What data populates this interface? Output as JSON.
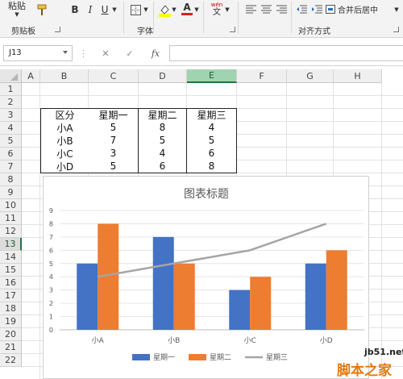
{
  "ribbon": {
    "paste_label": "粘贴",
    "bold": "B",
    "italic": "I",
    "underline": "U",
    "font_color_letter": "A",
    "phonetic_label": "wén",
    "phonetic_char": "文",
    "merge_center_label": "合并后居中",
    "groups": {
      "clipboard": "剪贴板",
      "font": "字体",
      "alignment": "对齐方式"
    }
  },
  "formula_bar": {
    "name_box": "J13",
    "cancel": "✕",
    "enter": "✓",
    "fx": "fx",
    "formula": ""
  },
  "sheet": {
    "columns": [
      "A",
      "B",
      "C",
      "D",
      "E",
      "F",
      "G",
      "H"
    ],
    "active_column": "E",
    "rows": [
      "1",
      "2",
      "3",
      "4",
      "5",
      "6",
      "7",
      "8",
      "9",
      "10",
      "11",
      "12",
      "13",
      "14",
      "15",
      "16",
      "17",
      "18",
      "19",
      "20",
      "21",
      "22"
    ],
    "active_row": "13",
    "table": {
      "header": [
        "区分",
        "星期一",
        "星期二",
        "星期三"
      ],
      "rows": [
        [
          "小A",
          "5",
          "8",
          "4"
        ],
        [
          "小B",
          "7",
          "5",
          "5"
        ],
        [
          "小C",
          "3",
          "4",
          "6"
        ],
        [
          "小D",
          "5",
          "6",
          "8"
        ]
      ]
    }
  },
  "chart_data": {
    "type": "bar",
    "title": "图表标题",
    "categories": [
      "小A",
      "小B",
      "小C",
      "小D"
    ],
    "series": [
      {
        "name": "星期一",
        "kind": "bar",
        "color": "#4472c4",
        "values": [
          5,
          7,
          3,
          5
        ]
      },
      {
        "name": "星期二",
        "kind": "bar",
        "color": "#ed7d31",
        "values": [
          8,
          5,
          4,
          6
        ]
      },
      {
        "name": "星期三",
        "kind": "line",
        "color": "#a5a5a5",
        "values": [
          4,
          5,
          6,
          8
        ]
      }
    ],
    "y_ticks": [
      "0",
      "1",
      "2",
      "3",
      "4",
      "5",
      "6",
      "7",
      "8",
      "9"
    ],
    "ylim": [
      0,
      9
    ],
    "grid": true,
    "legend_position": "bottom"
  },
  "watermark": {
    "site": "jb51.net",
    "name": "脚本之家"
  }
}
